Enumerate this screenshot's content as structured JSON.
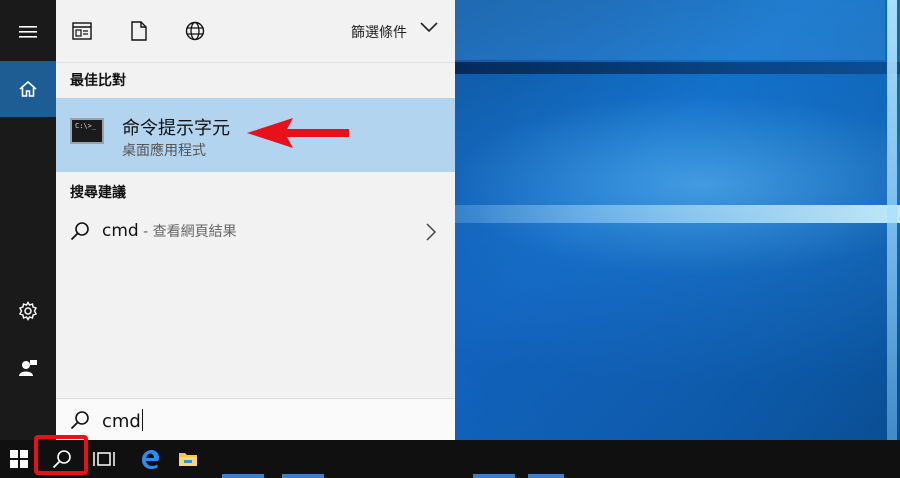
{
  "left_rail": {
    "menu_icon": "hamburger-icon",
    "home_icon": "home-icon",
    "settings_icon": "gear-icon",
    "user_icon": "user-feedback-icon"
  },
  "filter_bar": {
    "icons": [
      "documents-filter-icon",
      "file-filter-icon",
      "web-filter-icon"
    ],
    "filters_label": "篩選條件"
  },
  "best_match": {
    "header": "最佳比對",
    "app_name": "命令提示字元",
    "app_type": "桌面應用程式",
    "icon_text": "C:\\>_"
  },
  "suggestions": {
    "header": "搜尋建議",
    "items": [
      {
        "query": "cmd",
        "hint": " - 查看網頁結果"
      }
    ]
  },
  "search_box": {
    "value": "cmd"
  },
  "taskbar": {
    "items": [
      "start-icon",
      "search-icon",
      "task-view-icon",
      "edge-icon",
      "file-explorer-icon"
    ]
  },
  "colors": {
    "accent": "#1e5d93",
    "selection": "#b3d4ee",
    "annotation_red": "#e8101a"
  }
}
